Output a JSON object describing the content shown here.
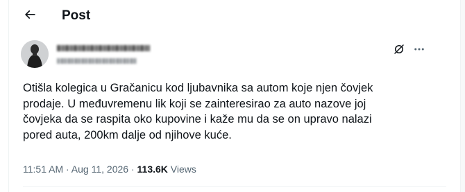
{
  "header": {
    "title": "Post",
    "back_icon": "arrow-left-icon"
  },
  "author": {
    "avatar_icon": "avatar-silhouette",
    "name_obscured": true,
    "handle_obscured": true
  },
  "actions": {
    "grok_icon": "grok-slash-circle-icon",
    "more_icon": "more-dots-icon"
  },
  "post": {
    "lines": [
      "Otišla kolegica u Gračanicu kod ljubavnika sa autom koje njen čovjek",
      "prodaje. U međuvremenu lik koji se zainteresirao za auto nazove joj",
      "čovjeka da se raspita oko kupovine i kaže mu da se on upravo nalazi",
      "pored auta, 200km dalje od njihove kuće."
    ],
    "time": "11:51 AM",
    "separator": " · ",
    "date": "Aug 11, 2026",
    "views_count": "113.6K",
    "views_label": " Views"
  },
  "colors": {
    "text": "#0f1419",
    "secondary": "#536471",
    "border": "#eff3f4"
  }
}
